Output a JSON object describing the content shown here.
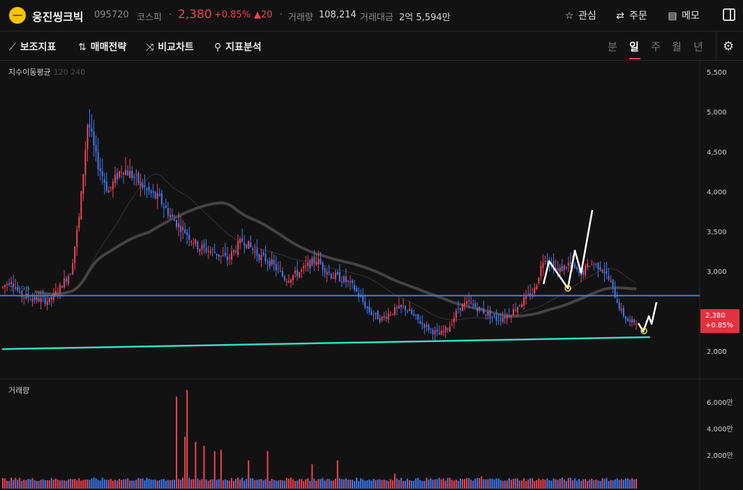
{
  "header": {
    "stock_name": "웅진씽크빅",
    "code": "095720",
    "market": "코스피",
    "price": "2,380",
    "change_pct": "+0.85%",
    "change_abs": "▲20",
    "volume_label": "거래량",
    "volume_value": "108,214",
    "amount_label": "거래대금",
    "amount_value": "2억 5,594만",
    "interest_label": "관심",
    "order_label": "주문",
    "memo_label": "메모"
  },
  "toolbar": {
    "indicator_label": "보조지표",
    "strategy_label": "매매전략",
    "compare_label": "비교차트",
    "analysis_label": "지표분석",
    "periods": [
      "분",
      "일",
      "주",
      "월",
      "년"
    ],
    "active_period": "일"
  },
  "chart_labels": {
    "ma_label": "지수이동평균",
    "ma_params": "120 240",
    "volume_panel_label": "거래량",
    "hline_value": "2,696",
    "current_price": "2,380",
    "current_change": "+0.85%"
  },
  "colors": {
    "up": "#f04452",
    "down": "#3d7bf7",
    "horizontal_line": "#2f86e8",
    "trend_line": "#33e0c2",
    "background": "#121212"
  },
  "chart_data": [
    {
      "type": "candlestick",
      "y_ticks": [
        2000,
        2500,
        3000,
        3500,
        4000,
        4500,
        5000,
        5500
      ],
      "y_tick_labels": [
        "2,000",
        "2,500",
        "3,000",
        "3,500",
        "4,000",
        "4,500",
        "5,000",
        "5,500"
      ],
      "ylim": [
        1850,
        5550
      ],
      "n_bars": 300,
      "price_path": [
        [
          0,
          2800
        ],
        [
          5,
          2900
        ],
        [
          10,
          2700
        ],
        [
          20,
          2650
        ],
        [
          28,
          2630
        ],
        [
          32,
          2750
        ],
        [
          40,
          3000
        ],
        [
          45,
          3700
        ],
        [
          50,
          4900
        ],
        [
          55,
          4400
        ],
        [
          62,
          4000
        ],
        [
          70,
          4300
        ],
        [
          76,
          4200
        ],
        [
          85,
          4000
        ],
        [
          92,
          3900
        ],
        [
          100,
          3650
        ],
        [
          107,
          3500
        ],
        [
          115,
          3300
        ],
        [
          123,
          3250
        ],
        [
          132,
          3150
        ],
        [
          141,
          3400
        ],
        [
          150,
          3200
        ],
        [
          158,
          3100
        ],
        [
          166,
          2900
        ],
        [
          175,
          3000
        ],
        [
          184,
          3150
        ],
        [
          193,
          2950
        ],
        [
          200,
          2900
        ],
        [
          206,
          2800
        ],
        [
          215,
          2500
        ],
        [
          222,
          2400
        ],
        [
          229,
          2500
        ],
        [
          236,
          2550
        ],
        [
          243,
          2400
        ],
        [
          249,
          2300
        ],
        [
          256,
          2200
        ],
        [
          262,
          2300
        ],
        [
          268,
          2550
        ],
        [
          274,
          2600
        ],
        [
          282,
          2500
        ],
        [
          290,
          2400
        ],
        [
          297,
          2450
        ],
        [
          304,
          2600
        ],
        [
          312,
          2750
        ],
        [
          318,
          3200
        ],
        [
          326,
          3000
        ],
        [
          333,
          3100
        ],
        [
          339,
          2950
        ],
        [
          345,
          3100
        ],
        [
          352,
          3050
        ],
        [
          357,
          2850
        ],
        [
          363,
          2500
        ],
        [
          368,
          2350
        ],
        [
          372,
          2380
        ]
      ],
      "horizontal_line": 2696,
      "ma_120_note": "smooth gray moving average"
    },
    {
      "type": "bar",
      "name": "거래량",
      "y_ticks": [
        2000,
        4000,
        6000
      ],
      "y_tick_labels": [
        "2,000만",
        "4,000만",
        "6,000만"
      ],
      "ylim": [
        0,
        7000
      ],
      "spikes": [
        [
          82,
          6400
        ],
        [
          86,
          3400
        ],
        [
          87,
          6900
        ],
        [
          91,
          3000
        ],
        [
          95,
          2700
        ],
        [
          100,
          2300
        ],
        [
          103,
          2400
        ],
        [
          116,
          1600
        ],
        [
          125,
          2300
        ],
        [
          146,
          1300
        ],
        [
          158,
          1600
        ],
        [
          185,
          600
        ],
        [
          226,
          400
        ],
        [
          303,
          1300
        ],
        [
          323,
          300
        ],
        [
          345,
          350
        ]
      ]
    }
  ]
}
